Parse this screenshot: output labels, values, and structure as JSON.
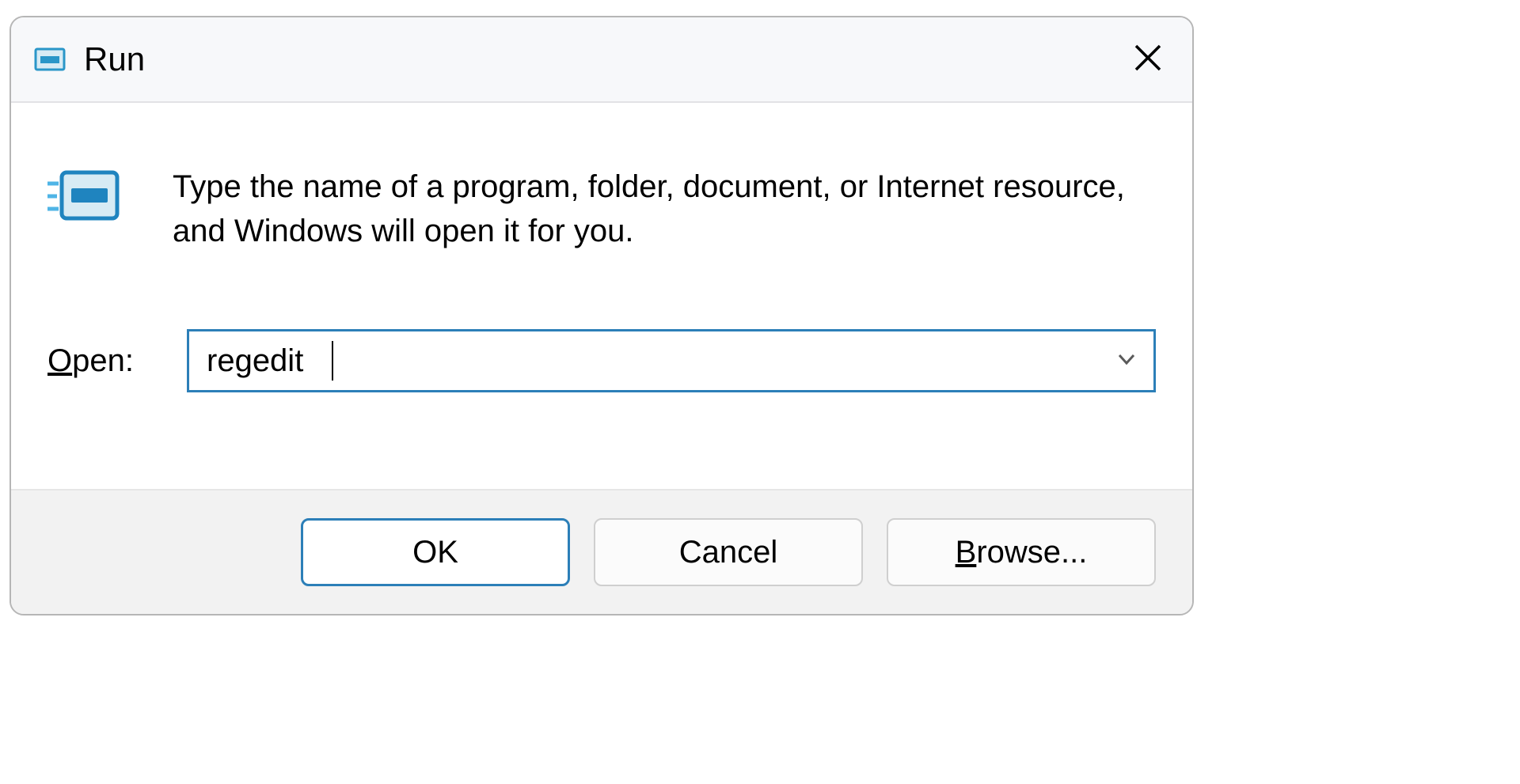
{
  "dialog": {
    "title": "Run",
    "description": "Type the name of a program, folder, document, or Internet resource, and Windows will open it for you.",
    "open_label_pre": "O",
    "open_label_post": "pen:",
    "input_value": "regedit",
    "buttons": {
      "ok": "OK",
      "cancel": "Cancel",
      "browse_pre": "B",
      "browse_post": "rowse..."
    }
  }
}
